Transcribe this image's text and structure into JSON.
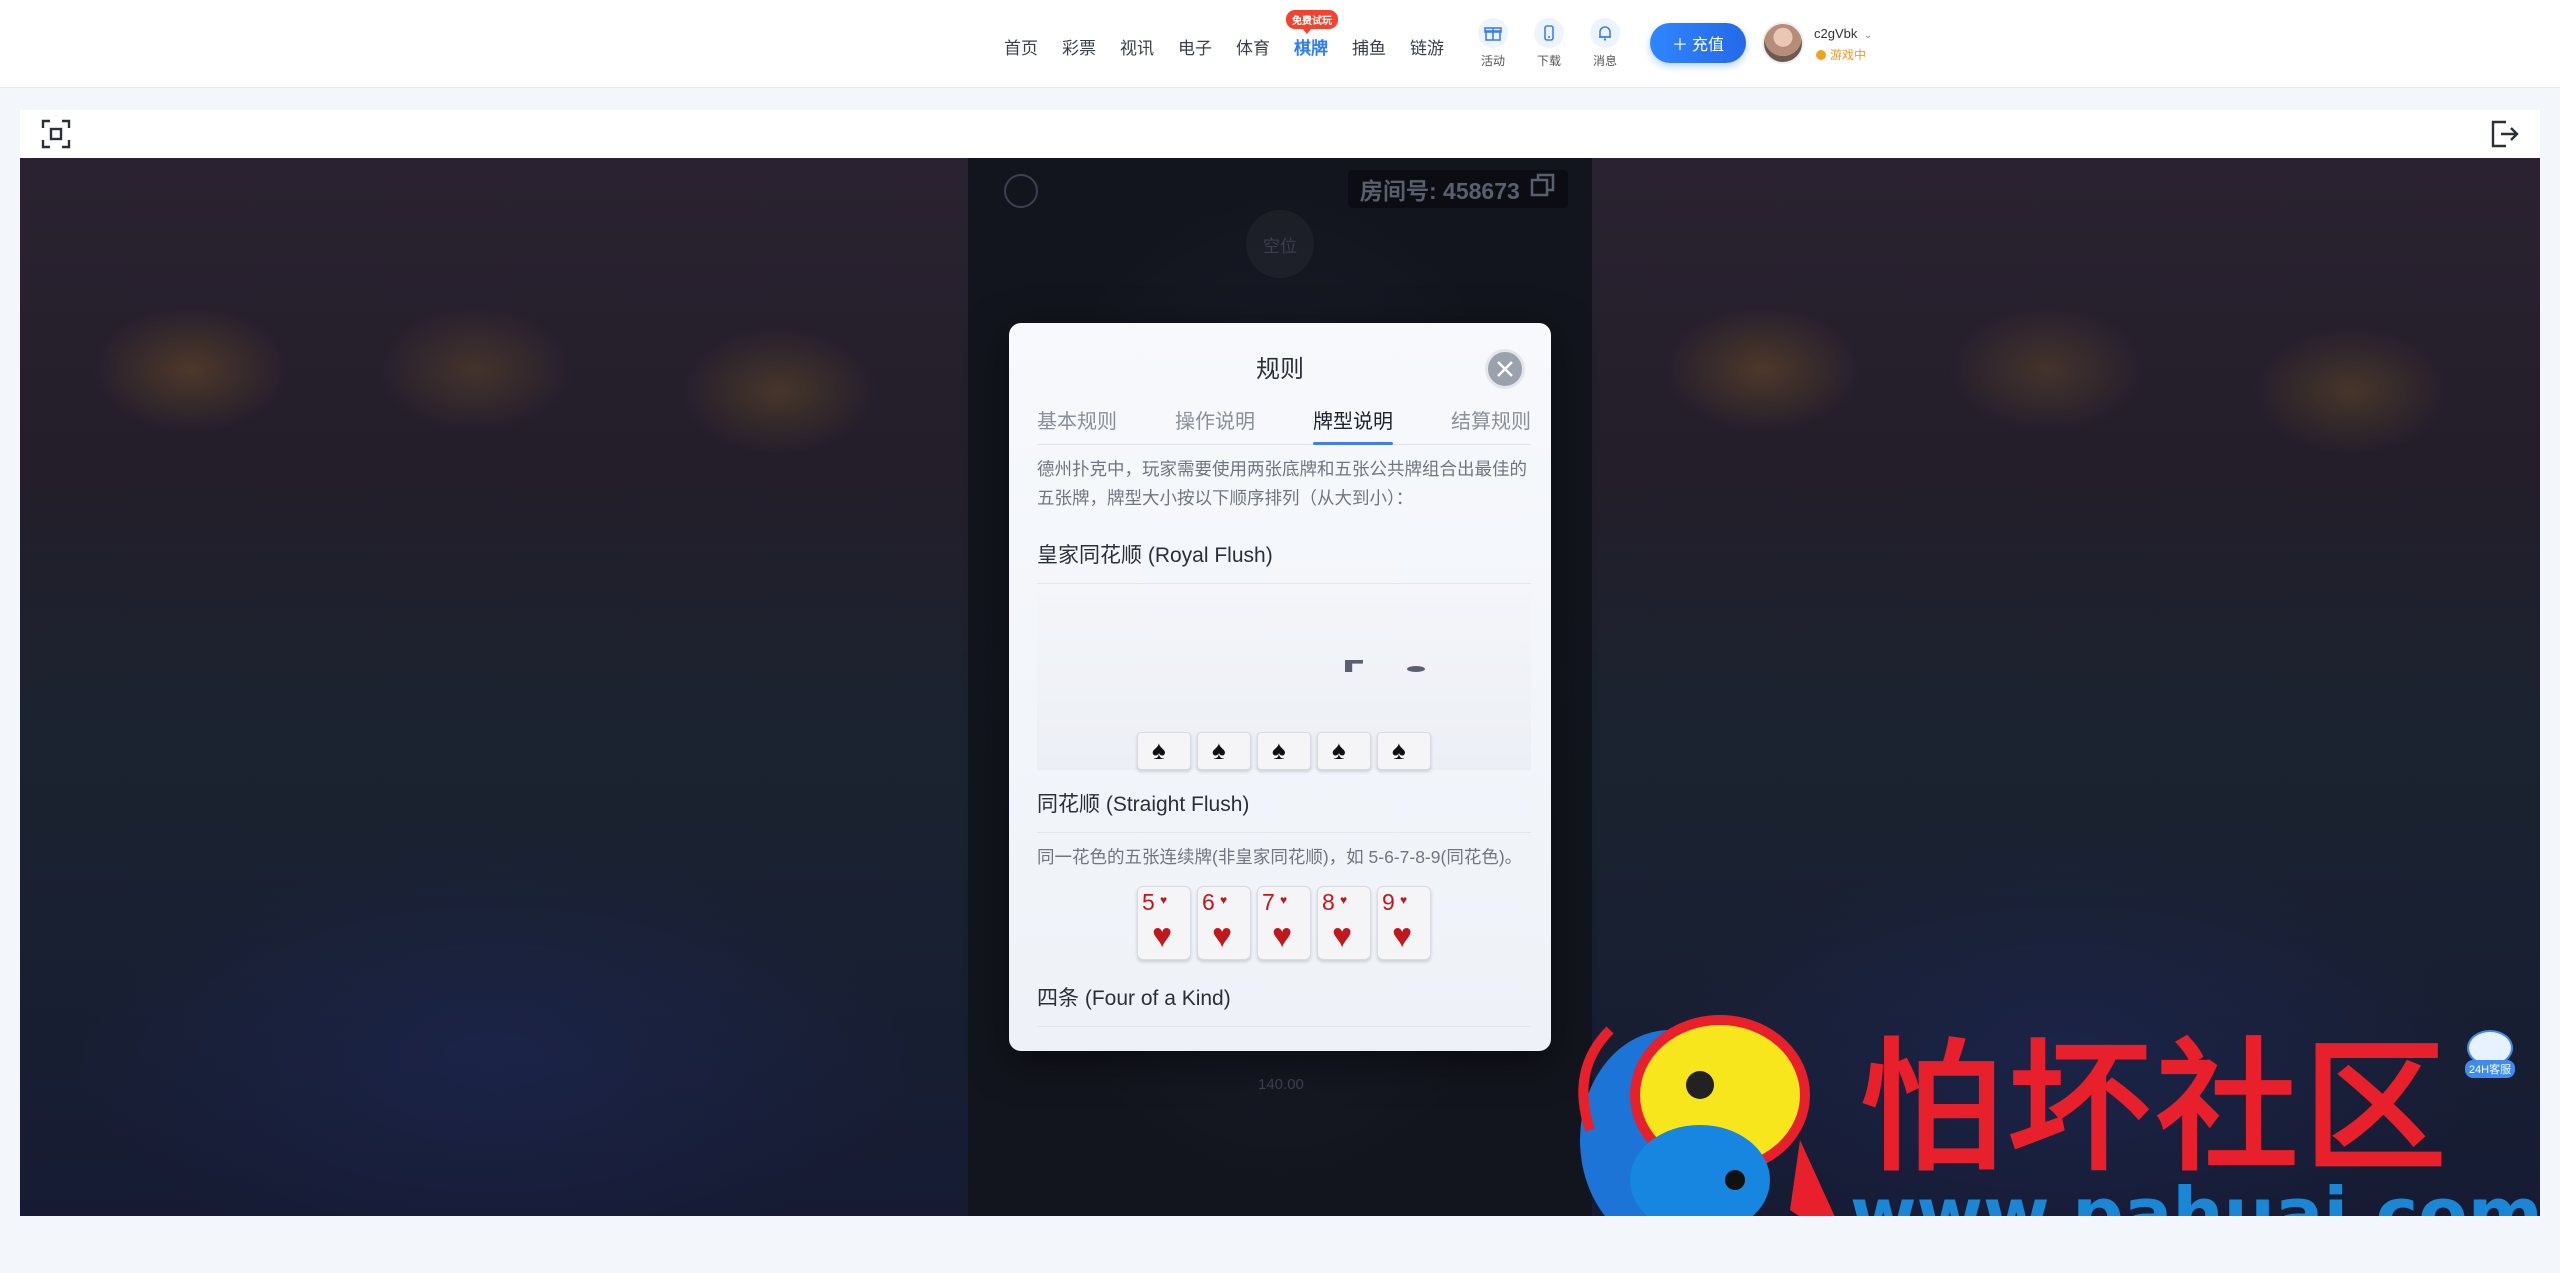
{
  "nav": {
    "items": [
      {
        "label": "首页"
      },
      {
        "label": "彩票"
      },
      {
        "label": "视讯"
      },
      {
        "label": "电子"
      },
      {
        "label": "体育"
      },
      {
        "label": "棋牌",
        "badge": "免费试玩"
      },
      {
        "label": "捕鱼"
      },
      {
        "label": "链游"
      }
    ],
    "quick": [
      {
        "label": "活动",
        "icon": "gift-icon"
      },
      {
        "label": "下载",
        "icon": "phone-icon"
      },
      {
        "label": "消息",
        "icon": "bell-icon"
      }
    ],
    "recharge_label": "充值"
  },
  "user": {
    "name": "c2gVbk",
    "status": "游戏中"
  },
  "game": {
    "room_label": "房间号: 458673",
    "seat_empty": "空位",
    "chip_value": "140.00"
  },
  "modal": {
    "title": "规则",
    "tabs": [
      "基本规则",
      "操作说明",
      "牌型说明",
      "结算规则"
    ],
    "active_tab": 2,
    "intro": "德州扑克中，玩家需要使用两张底牌和五张公共牌组合出最佳的五张牌，牌型大小按以下顺序排列（从大到小）：",
    "hands": [
      {
        "title": "皇家同花顺 (Royal Flush)"
      },
      {
        "title": "同花顺 (Straight Flush)",
        "desc": "同一花色的五张连续牌(非皇家同花顺)，如 5-6-7-8-9(同花色)。"
      },
      {
        "title": "四条 (Four of a Kind)"
      }
    ],
    "straight_cards": [
      {
        "rank": "5",
        "suit": "♥"
      },
      {
        "rank": "6",
        "suit": "♥"
      },
      {
        "rank": "7",
        "suit": "♥"
      },
      {
        "rank": "8",
        "suit": "♥"
      },
      {
        "rank": "9",
        "suit": "♥"
      }
    ],
    "royal_card_suit": "♠"
  },
  "watermark": {
    "text": "怕坏社区",
    "url": "www.pahuai.com"
  },
  "support": {
    "label": "24H客服"
  },
  "colors": {
    "accent": "#2e7cf6",
    "card_red": "#c0181c",
    "watermark_red": "#e8202b",
    "watermark_blue": "#1a86d6"
  }
}
